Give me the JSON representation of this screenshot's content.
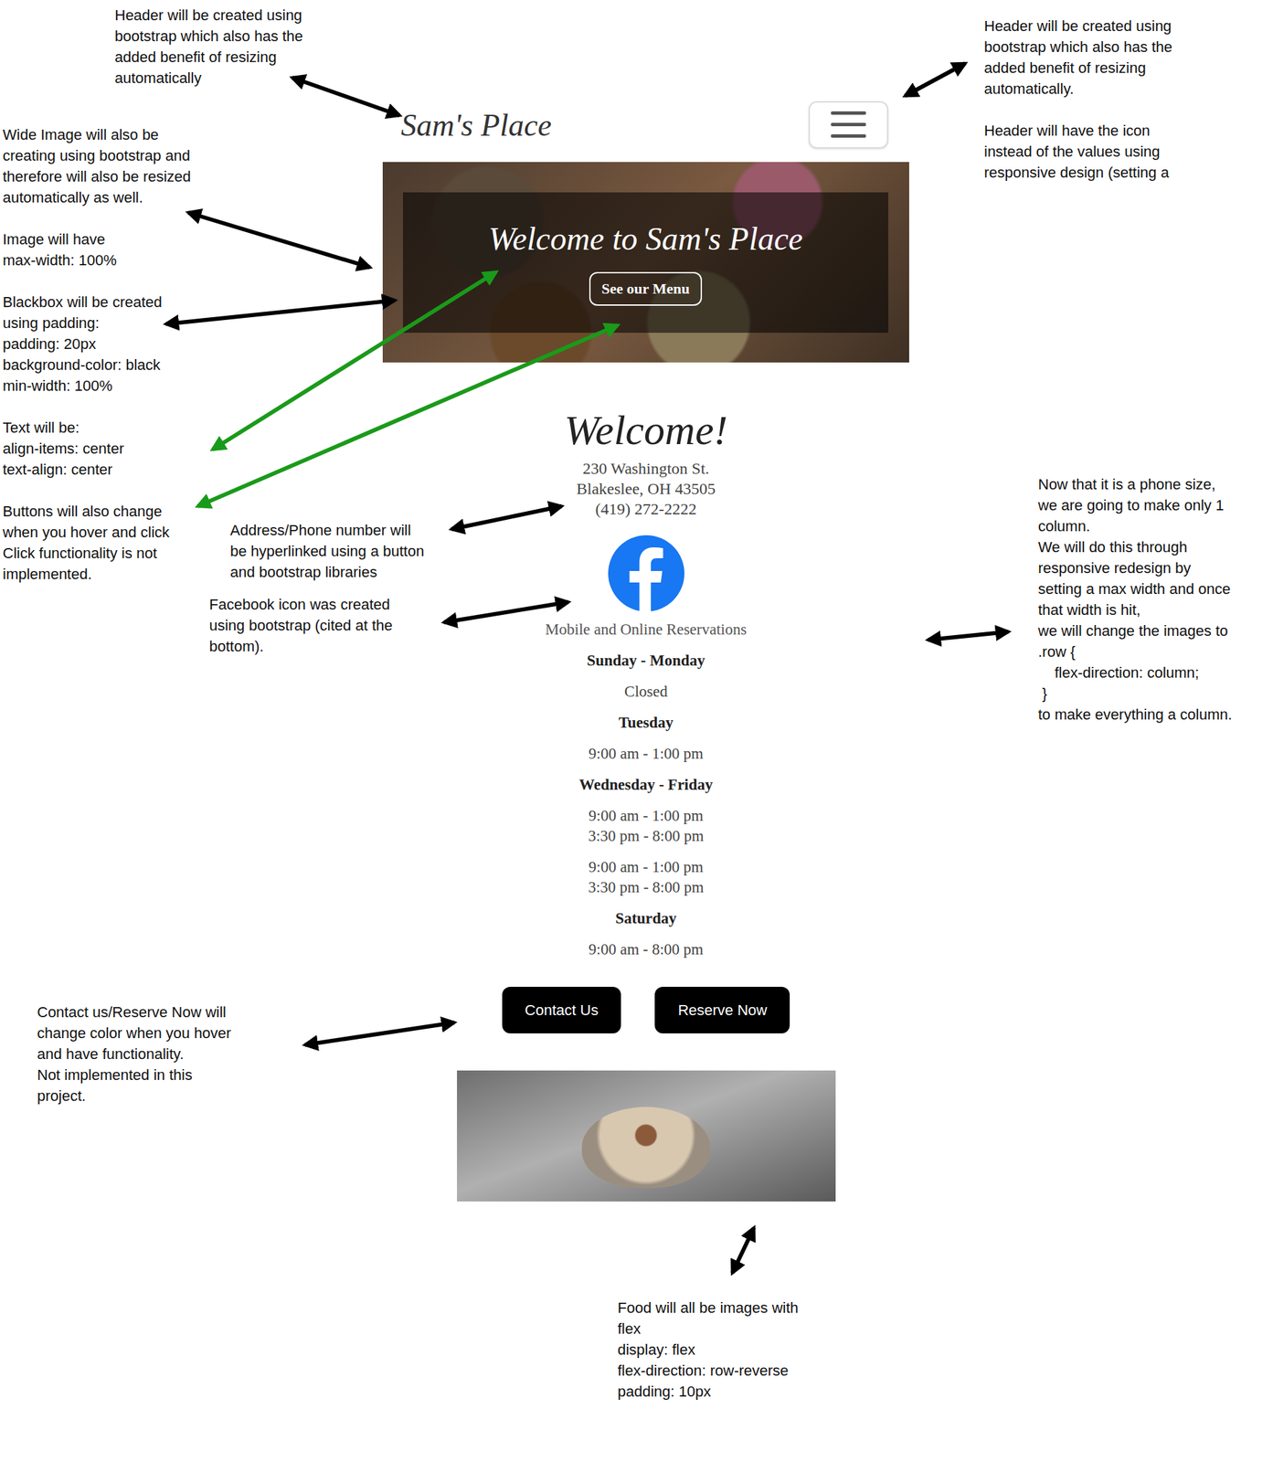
{
  "header": {
    "logo": "Sam's Place"
  },
  "hero": {
    "title": "Welcome to Sam's Place",
    "button": "See our Menu"
  },
  "welcome": "Welcome!",
  "address": [
    "230 Washington St.",
    "Blakeslee, OH 43505",
    "(419) 272-2222"
  ],
  "reservations": "Mobile and Online Reservations",
  "hours": [
    {
      "day": "Sunday - Monday",
      "blocks": [
        [
          "Closed"
        ]
      ]
    },
    {
      "day": "Tuesday",
      "blocks": [
        [
          "9:00 am - 1:00 pm"
        ]
      ]
    },
    {
      "day": "Wednesday - Friday",
      "blocks": [
        [
          "9:00 am - 1:00 pm",
          "3:30 pm - 8:00 pm"
        ],
        [
          "9:00 am - 1:00 pm",
          "3:30 pm - 8:00 pm"
        ]
      ]
    },
    {
      "day": "Saturday",
      "blocks": [
        [
          "9:00 am - 8:00 pm"
        ]
      ]
    }
  ],
  "buttons": [
    "Contact Us",
    "Reserve Now"
  ],
  "annotations": [
    {
      "paragraphs": [
        [
          "Header will be created using",
          "bootstrap which also has the",
          "added benefit of resizing",
          "automatically"
        ]
      ]
    },
    {
      "paragraphs": [
        [
          "Header will be created using",
          "bootstrap which also has the",
          "added benefit of resizing",
          "automatically."
        ],
        [
          "Header will have the icon",
          "instead of the values using",
          "responsive design (setting a"
        ]
      ]
    },
    {
      "paragraphs": [
        [
          "Wide Image will also be",
          "creating using bootstrap and",
          "therefore will also be resized",
          "automatically as well."
        ],
        [
          "Image will have",
          "max-width: 100%"
        ],
        [
          "Blackbox will be created",
          "using padding:",
          "padding: 20px",
          "background-color: black",
          "min-width: 100%"
        ],
        [
          "Text will be:",
          "align-items: center",
          "text-align: center"
        ],
        [
          "Buttons will also change",
          "when you hover and click",
          "Click functionality is not",
          "implemented."
        ]
      ]
    },
    {
      "paragraphs": [
        [
          "Address/Phone number will",
          "be hyperlinked using a button",
          "and bootstrap libraries"
        ]
      ]
    },
    {
      "paragraphs": [
        [
          "Facebook icon was created",
          "using bootstrap (cited at the",
          "bottom)."
        ]
      ]
    },
    {
      "paragraphs": [
        [
          "Now that it is a phone size,",
          "we are going to make only 1",
          "column.",
          "We will do this through",
          "responsive redesign by",
          "setting a max width and once",
          "that width is hit,",
          "we will change the images to",
          ".row {",
          "    flex-direction: column;",
          " }",
          "to make everything a column."
        ]
      ]
    },
    {
      "paragraphs": [
        [
          "Contact us/Reserve Now will",
          "change color when you hover",
          "and have functionality.",
          "Not implemented in this",
          "project."
        ]
      ]
    },
    {
      "paragraphs": [
        [
          "Food will all be images with",
          "flex",
          "display: flex",
          "flex-direction: row-reverse",
          "padding: 10px"
        ]
      ]
    }
  ],
  "arrows": [
    {
      "color": "#000000"
    },
    {
      "color": "#000000"
    },
    {
      "color": "#000000"
    },
    {
      "color": "#000000"
    },
    {
      "color": "#1a9a1a"
    },
    {
      "color": "#1a9a1a"
    },
    {
      "color": "#000000"
    },
    {
      "color": "#000000"
    },
    {
      "color": "#000000"
    },
    {
      "color": "#000000"
    },
    {
      "color": "#000000"
    }
  ]
}
